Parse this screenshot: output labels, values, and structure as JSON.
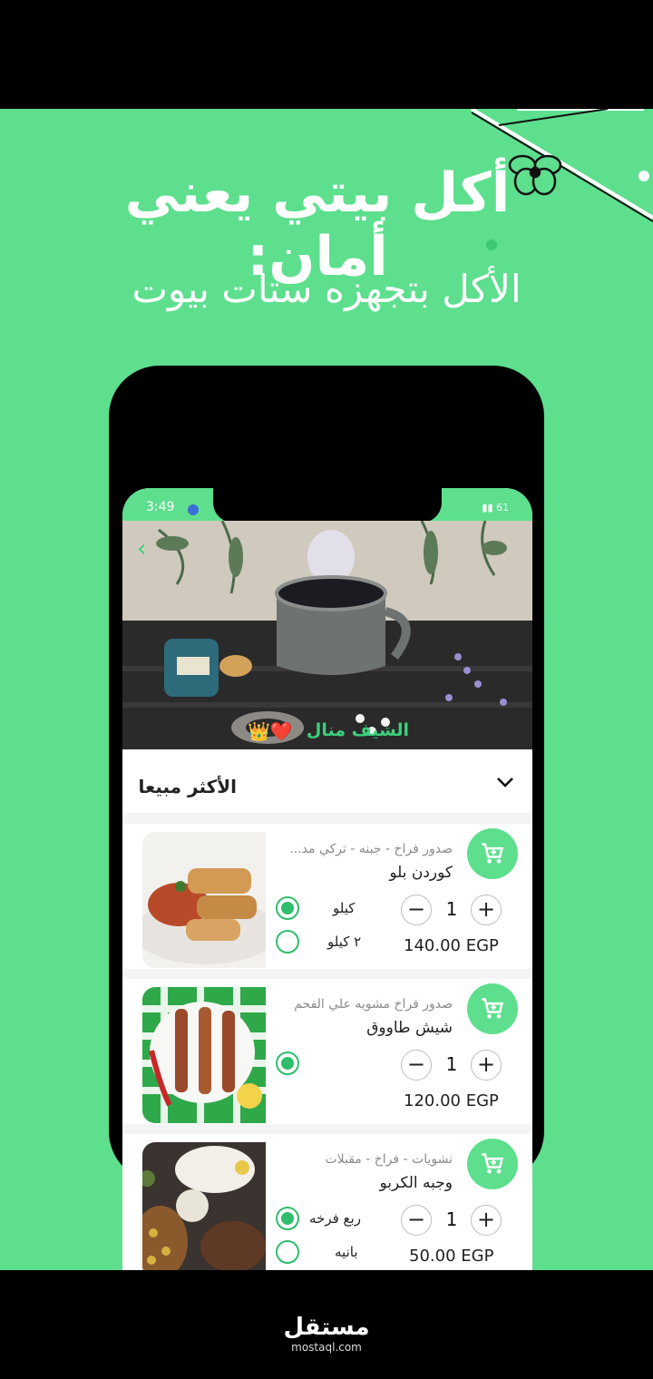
{
  "headline": "أكل بيتي يعني أمان:",
  "subline": "الأكل بتجهزه ستات بيوت",
  "status": {
    "time": "3:49",
    "battery": "61"
  },
  "hero": {
    "chef_label": "الشيف منال",
    "emoji": "👑❤️"
  },
  "section": {
    "title": "الأكثر مبيعا"
  },
  "products": [
    {
      "description": "صدور فراخ - جبنه - تركي مد...",
      "name": "كوردن بلو",
      "quantity": "1",
      "options": [
        "كيلو",
        "٢ كيلو"
      ],
      "price": "140.00 EGP"
    },
    {
      "description": "صدور فراخ مشويه علي الفحم",
      "name": "شيش طاووق",
      "quantity": "1",
      "options": [],
      "price": "120.00 EGP"
    },
    {
      "description": "نشويات - فراخ - مقبلات",
      "name": "وجبه الكربو",
      "quantity": "1",
      "options": [
        "ربع فرخه",
        "بانيه"
      ],
      "price": "50.00 EGP"
    }
  ],
  "watermark": {
    "text": "مستقل",
    "sub": "mostaql.com"
  }
}
